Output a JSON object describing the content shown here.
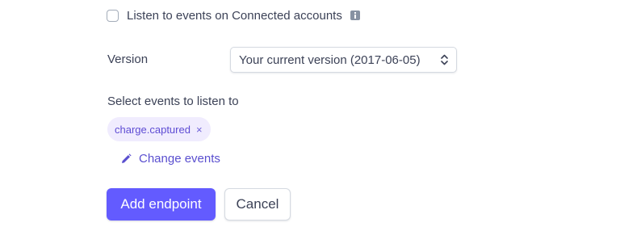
{
  "connected_accounts": {
    "label": "Listen to events on Connected accounts",
    "checked": false,
    "icon": "info-icon"
  },
  "version": {
    "label": "Version",
    "selected": "Your current version (2017-06-05)",
    "icon": "chevron-updown-icon"
  },
  "events": {
    "heading": "Select events to listen to",
    "selected": [
      {
        "label": "charge.captured",
        "remove_glyph": "×"
      }
    ],
    "change_label": "Change events",
    "change_icon": "pencil-icon"
  },
  "actions": {
    "submit_label": "Add endpoint",
    "cancel_label": "Cancel"
  },
  "colors": {
    "accent": "#635bff",
    "pill_bg": "#f0ecfe",
    "link": "#5a4fcf",
    "text": "#3c4257"
  }
}
